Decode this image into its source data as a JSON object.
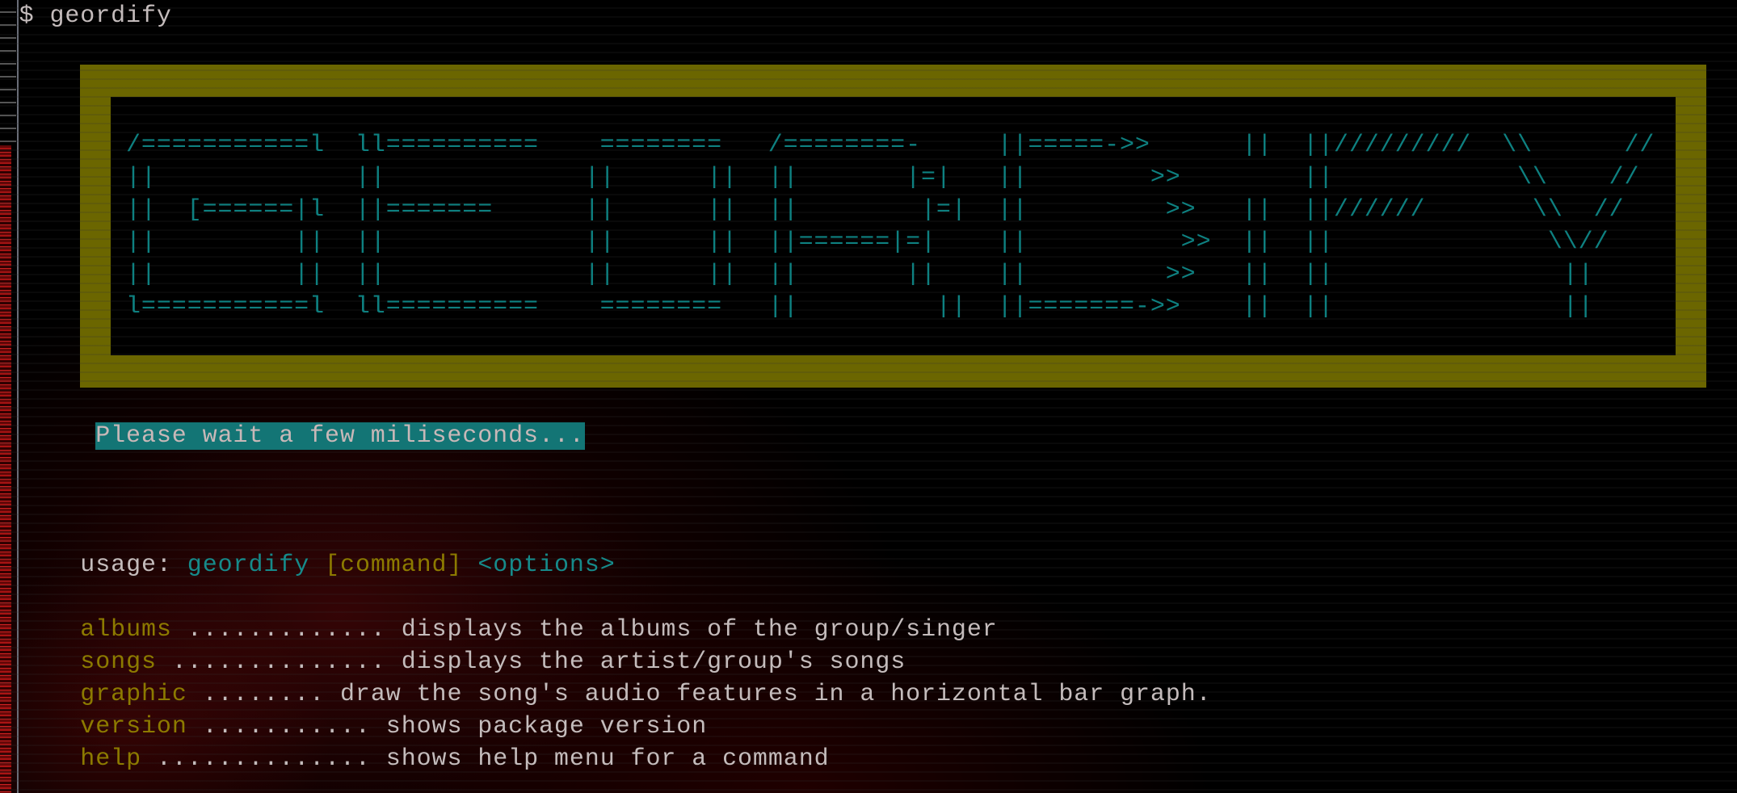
{
  "terminal": {
    "prompt": "$ geordify",
    "banner_frame_color": "#6b6600",
    "art_color": "#0e8080",
    "art_lines": [
      "/===========l  ll==========    ========   /========-     ||=====->>      ||  ||/////////  \\\\      //",
      "||             ||             ||      ||  ||       |=|   ||        >>        ||            \\\\    //",
      "||  [======|l  ||=======      ||      ||  ||        |=|  ||         >>   ||  ||//////       \\\\  //",
      "||         ||  ||             ||      ||  ||======|=|    ||          >>  ||  ||              \\\\//",
      "||         ||  ||             ||      ||  ||       ||    ||         >>   ||  ||               ||",
      "l===========l  ll==========    ========   ||         ||  ||=======->>    ||  ||               ||"
    ],
    "message": "Please wait a few miliseconds...",
    "usage": {
      "label": "usage: ",
      "program": "geordify",
      "command": "[command]",
      "options": "<options>"
    },
    "commands": [
      {
        "name": "albums",
        "dots": " ............. ",
        "description": "displays the albums of the group/singer"
      },
      {
        "name": "songs",
        "dots": " .............. ",
        "description": "displays the artist/group's songs"
      },
      {
        "name": "graphic",
        "dots": " ........ ",
        "description": "draw the song's audio features in a horizontal bar graph."
      },
      {
        "name": "version",
        "dots": " ........... ",
        "description": "shows package version"
      },
      {
        "name": "help",
        "dots": " .............. ",
        "description": "shows help menu for a command"
      }
    ]
  }
}
